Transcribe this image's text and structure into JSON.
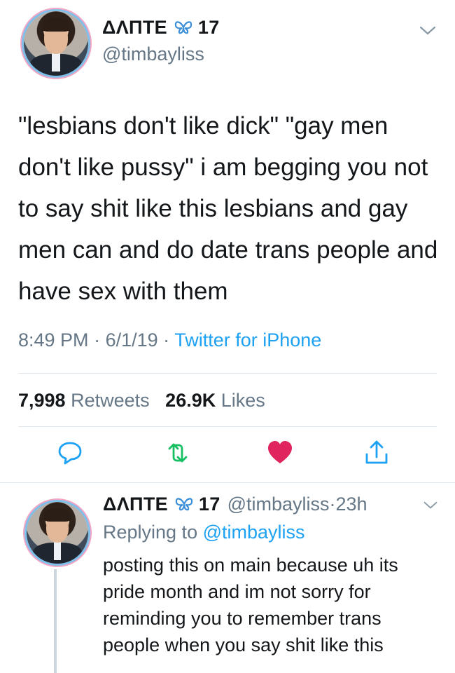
{
  "tweet": {
    "display_name": "ΔΛΠΤΕ",
    "name_suffix": "17",
    "handle": "@timbayliss",
    "text": "\"lesbians don't like dick\" \"gay men don't like pussy\" i am begging you not to say shit like this lesbians and gay men can and do date trans people and have sex with them",
    "time": "8:49 PM",
    "date": "6/1/19",
    "source": "Twitter for iPhone",
    "retweets_count": "7,998",
    "retweets_label": "Retweets",
    "likes_count": "26.9K",
    "likes_label": "Likes"
  },
  "reply": {
    "display_name": "ΔΛΠΤΕ",
    "name_suffix": "17",
    "handle": "@timbayliss",
    "age": "23h",
    "replying_prefix": "Replying to",
    "replying_handle": "@timbayliss",
    "text": "posting this on main because uh its pride month and im not sorry for reminding you to remember trans people when you say shit like this"
  },
  "icons": {
    "reply": "reply-icon",
    "retweet": "retweet-icon",
    "like": "heart-icon",
    "share": "share-icon",
    "emoji": "butterfly-icon",
    "menu": "chevron-down-icon"
  },
  "colors": {
    "link": "#1da1f2",
    "like": "#e0245e",
    "retweet": "#17bf63",
    "muted": "#657786",
    "text": "#14171a"
  }
}
